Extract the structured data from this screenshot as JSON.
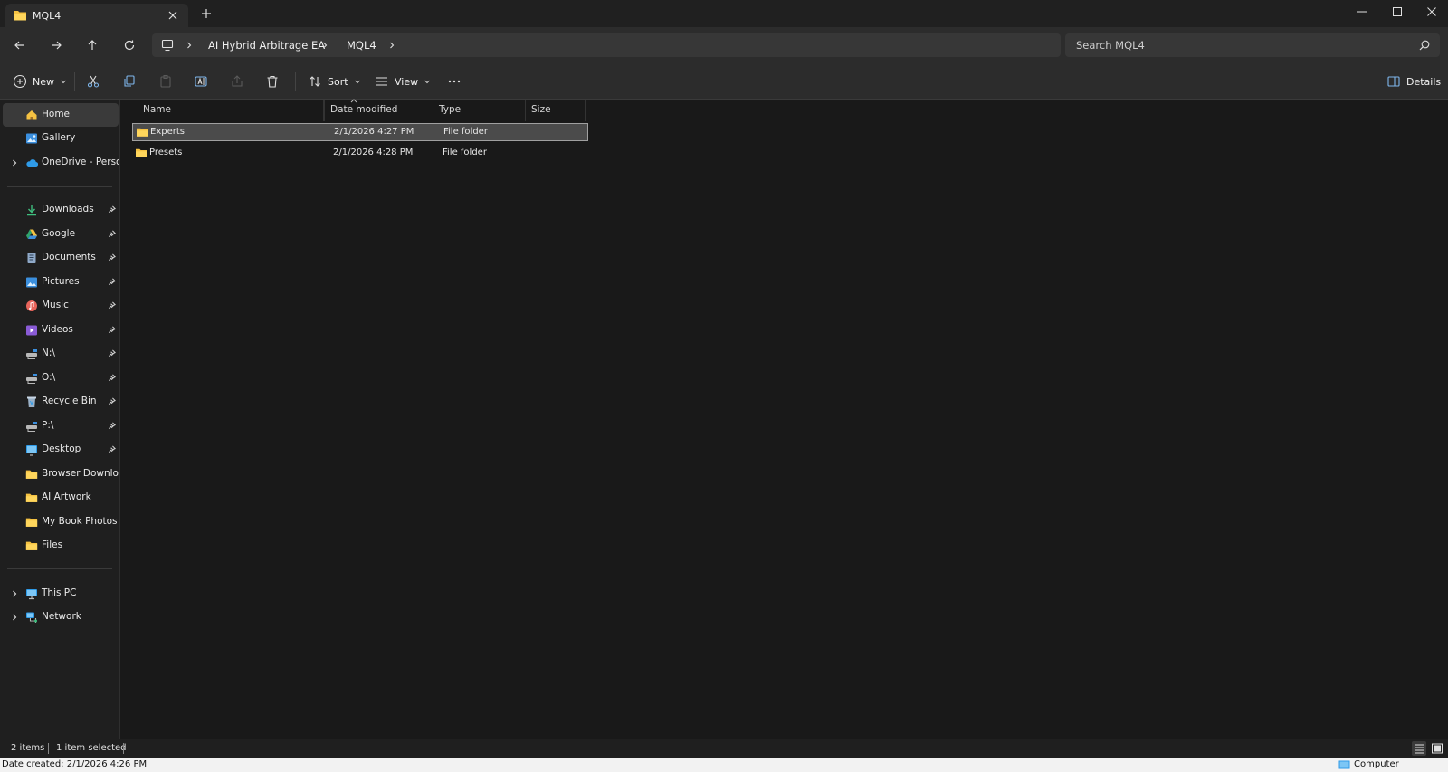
{
  "window": {
    "tab_title": "MQL4",
    "minimize_label": "Minimize",
    "maximize_label": "Maximize",
    "close_label": "Close"
  },
  "address_bar": {
    "breadcrumbs": [
      "AI Hybrid Arbitrage EA",
      "MQL4"
    ]
  },
  "search": {
    "placeholder": "Search MQL4"
  },
  "command_bar": {
    "new_label": "New",
    "sort_label": "Sort",
    "view_label": "View",
    "details_label": "Details"
  },
  "sidebar": {
    "top": [
      {
        "label": "Home",
        "icon": "home-icon",
        "selected": true
      },
      {
        "label": "Gallery",
        "icon": "gallery-icon"
      },
      {
        "label": "OneDrive - Persona",
        "icon": "cloud-icon",
        "expandable": true
      }
    ],
    "quick_access": [
      {
        "label": "Downloads",
        "icon": "download-icon",
        "pinned": true
      },
      {
        "label": "Google",
        "icon": "google-drive-icon",
        "pinned": true
      },
      {
        "label": "Documents",
        "icon": "documents-icon",
        "pinned": true
      },
      {
        "label": "Pictures",
        "icon": "pictures-icon",
        "pinned": true
      },
      {
        "label": "Music",
        "icon": "music-icon",
        "pinned": true
      },
      {
        "label": "Videos",
        "icon": "videos-icon",
        "pinned": true
      },
      {
        "label": "N:\\",
        "icon": "network-drive-icon",
        "pinned": true
      },
      {
        "label": "O:\\",
        "icon": "network-drive-icon",
        "pinned": true
      },
      {
        "label": "Recycle Bin",
        "icon": "recycle-bin-icon",
        "pinned": true
      },
      {
        "label": "P:\\",
        "icon": "network-drive-icon",
        "pinned": true
      },
      {
        "label": "Desktop",
        "icon": "desktop-icon",
        "pinned": true
      },
      {
        "label": "Browser Downloads",
        "icon": "folder-icon"
      },
      {
        "label": "AI Artwork",
        "icon": "folder-icon"
      },
      {
        "label": "My Book Photos",
        "icon": "folder-icon"
      },
      {
        "label": "Files",
        "icon": "folder-icon"
      }
    ],
    "bottom": [
      {
        "label": "This PC",
        "icon": "this-pc-icon",
        "expandable": true
      },
      {
        "label": "Network",
        "icon": "network-icon",
        "expandable": true
      }
    ]
  },
  "file_list": {
    "columns": [
      "Name",
      "Date modified",
      "Type",
      "Size"
    ],
    "rows": [
      {
        "name": "Experts",
        "date_modified": "2/1/2026 4:27 PM",
        "type": "File folder",
        "size": "",
        "selected": true
      },
      {
        "name": "Presets",
        "date_modified": "2/1/2026 4:28 PM",
        "type": "File folder",
        "size": "",
        "selected": false
      }
    ]
  },
  "status": {
    "item_count": "2 items",
    "selection": "1 item selected"
  },
  "info_bar": {
    "date_created": "Date created: 2/1/2026 4:26 PM",
    "location": "Computer"
  },
  "colors": {
    "folder": "#f5c242",
    "accent": "#4ca0e0",
    "background": "#191919"
  }
}
